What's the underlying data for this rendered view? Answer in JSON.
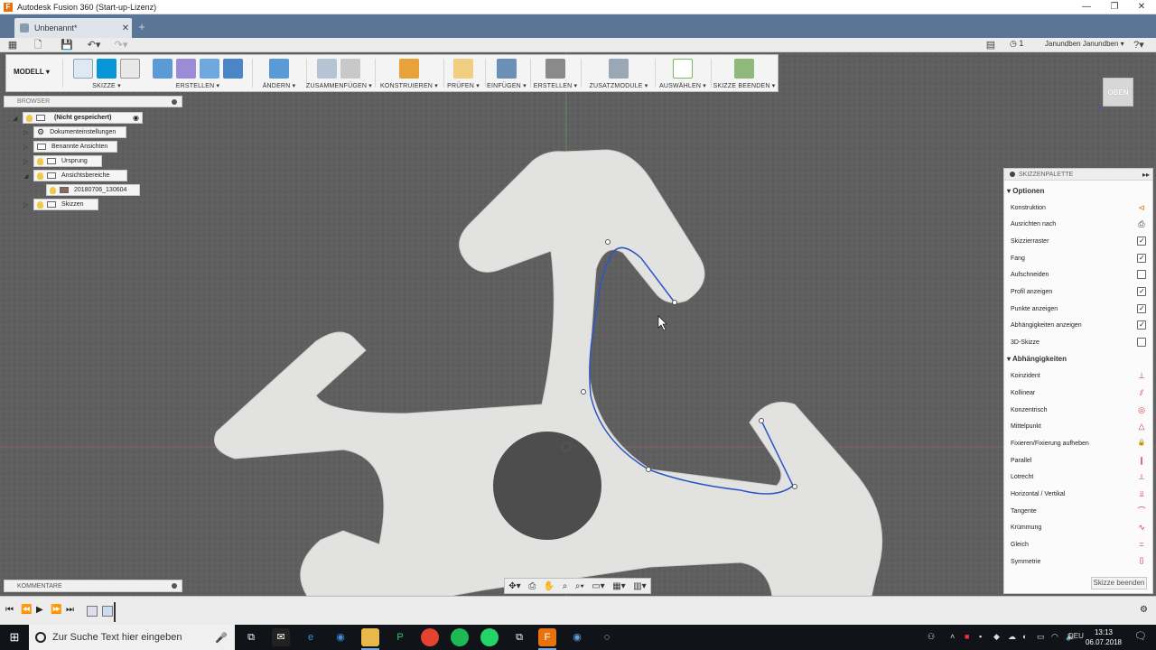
{
  "window": {
    "title": "Autodesk Fusion 360 (Start-up-Lizenz)",
    "app_icon": "fusion-f-icon",
    "controls": [
      "minimize-icon",
      "maximize-icon",
      "close-icon"
    ]
  },
  "doc_tab": {
    "label": "Unbenannt*"
  },
  "quickbar": {
    "jobs": "1",
    "user": "Janundben Janundben ▾",
    "help": "?"
  },
  "toolbar": {
    "workspace": "MODELL ▾",
    "groups": [
      {
        "label": "SKIZZE ▾"
      },
      {
        "label": "ERSTELLEN ▾"
      },
      {
        "label": "ÄNDERN ▾"
      },
      {
        "label": "ZUSAMMENFÜGEN ▾"
      },
      {
        "label": "KONSTRUIEREN ▾"
      },
      {
        "label": "PRÜFEN ▾"
      },
      {
        "label": "EINFÜGEN ▾"
      },
      {
        "label": "ERSTELLEN ▾"
      },
      {
        "label": "ZUSATZMODULE ▾"
      },
      {
        "label": "AUSWÄHLEN ▾"
      },
      {
        "label": "SKIZZE BEENDEN ▾"
      }
    ]
  },
  "browser": {
    "title": "BROWSER",
    "root": "(Nicht gespeichert)",
    "items": [
      {
        "label": "Dokumenteinstellungen"
      },
      {
        "label": "Benannte Ansichten"
      },
      {
        "label": "Ursprung"
      },
      {
        "label": "Ansichtsbereiche"
      },
      {
        "label": "20180706_130604"
      },
      {
        "label": "Skizzen"
      }
    ]
  },
  "comments": {
    "title": "KOMMENTARE"
  },
  "viewcube": {
    "label": "OBEN"
  },
  "palette": {
    "title": "SKIZZENPALETTE",
    "options_title": "Optionen",
    "options": [
      {
        "label": "Konstruktion",
        "control": "construction-icon"
      },
      {
        "label": "Ausrichten nach",
        "control": "look-at-icon"
      },
      {
        "label": "Skizzierraster",
        "control": "checkbox",
        "checked": true
      },
      {
        "label": "Fang",
        "control": "checkbox",
        "checked": true
      },
      {
        "label": "Aufschneiden",
        "control": "checkbox",
        "checked": false
      },
      {
        "label": "Profil anzeigen",
        "control": "checkbox",
        "checked": true
      },
      {
        "label": "Punkte anzeigen",
        "control": "checkbox",
        "checked": true
      },
      {
        "label": "Abhängigkeiten anzeigen",
        "control": "checkbox",
        "checked": true
      },
      {
        "label": "3D-Skizze",
        "control": "checkbox",
        "checked": false
      }
    ],
    "constraints_title": "Abhängigkeiten",
    "constraints": [
      {
        "label": "Koinzident",
        "icon": "coincident-icon",
        "glyph": "⊥"
      },
      {
        "label": "Kollinear",
        "icon": "collinear-icon",
        "glyph": "⫽"
      },
      {
        "label": "Konzentrisch",
        "icon": "concentric-icon",
        "glyph": "◎"
      },
      {
        "label": "Mittelpunkt",
        "icon": "midpoint-icon",
        "glyph": "△"
      },
      {
        "label": "Fixieren/Fixierung aufheben",
        "icon": "lock-icon",
        "glyph": "🔒"
      },
      {
        "label": "Parallel",
        "icon": "parallel-icon",
        "glyph": "∥"
      },
      {
        "label": "Lotrecht",
        "icon": "perpendicular-icon",
        "glyph": "⟂"
      },
      {
        "label": "Horizontal / Vertikal",
        "icon": "horizontal-vertical-icon",
        "glyph": "⫫"
      },
      {
        "label": "Tangente",
        "icon": "tangent-icon",
        "glyph": "⌒"
      },
      {
        "label": "Krümmung",
        "icon": "curvature-icon",
        "glyph": "∿"
      },
      {
        "label": "Gleich",
        "icon": "equal-icon",
        "glyph": "="
      },
      {
        "label": "Symmetrie",
        "icon": "symmetry-icon",
        "glyph": "[]"
      }
    ],
    "finish_button": "Skizze beenden"
  },
  "taskbar": {
    "search_placeholder": "Zur Suche Text hier eingeben",
    "lang": "DEU",
    "time": "13:13",
    "date": "06.07.2018"
  },
  "colors": {
    "sketch_curve": "#2a56c6",
    "accent": "#0696d7",
    "tabbar": "#5a7595"
  }
}
